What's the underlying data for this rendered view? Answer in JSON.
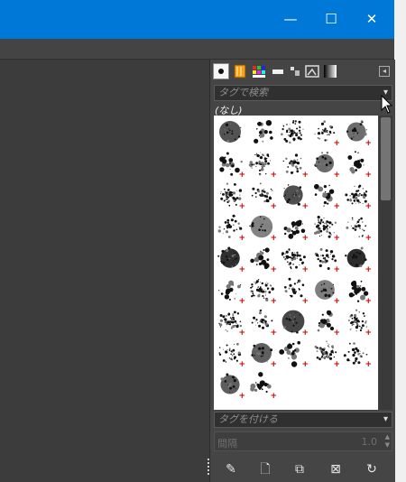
{
  "window": {
    "controls": [
      {
        "name": "minimize",
        "glyph": "—"
      },
      {
        "name": "maximize",
        "glyph": "☐"
      },
      {
        "name": "close",
        "glyph": "✕"
      }
    ]
  },
  "dock": {
    "tabs": [
      "brushes-tab",
      "patterns-tab",
      "gradients-tab",
      "palettes-tab",
      "fonts-tab",
      "tool-presets-tab",
      "images-tab",
      "dynamics-tab"
    ],
    "tag_search_placeholder": "タグで検索",
    "filter_label": "(なし)",
    "tag_assign_placeholder": "タグを付ける",
    "spacing": {
      "label": "間隔",
      "value": "1.0"
    },
    "buttons": [
      "edit-brush",
      "new-brush",
      "duplicate-brush",
      "delete-brush",
      "refresh-brushes"
    ],
    "brush_count": 42
  },
  "colors": {
    "title_bar": "#0078d7",
    "panel_bg": "#454545",
    "plus_marker": "#cc0000"
  }
}
